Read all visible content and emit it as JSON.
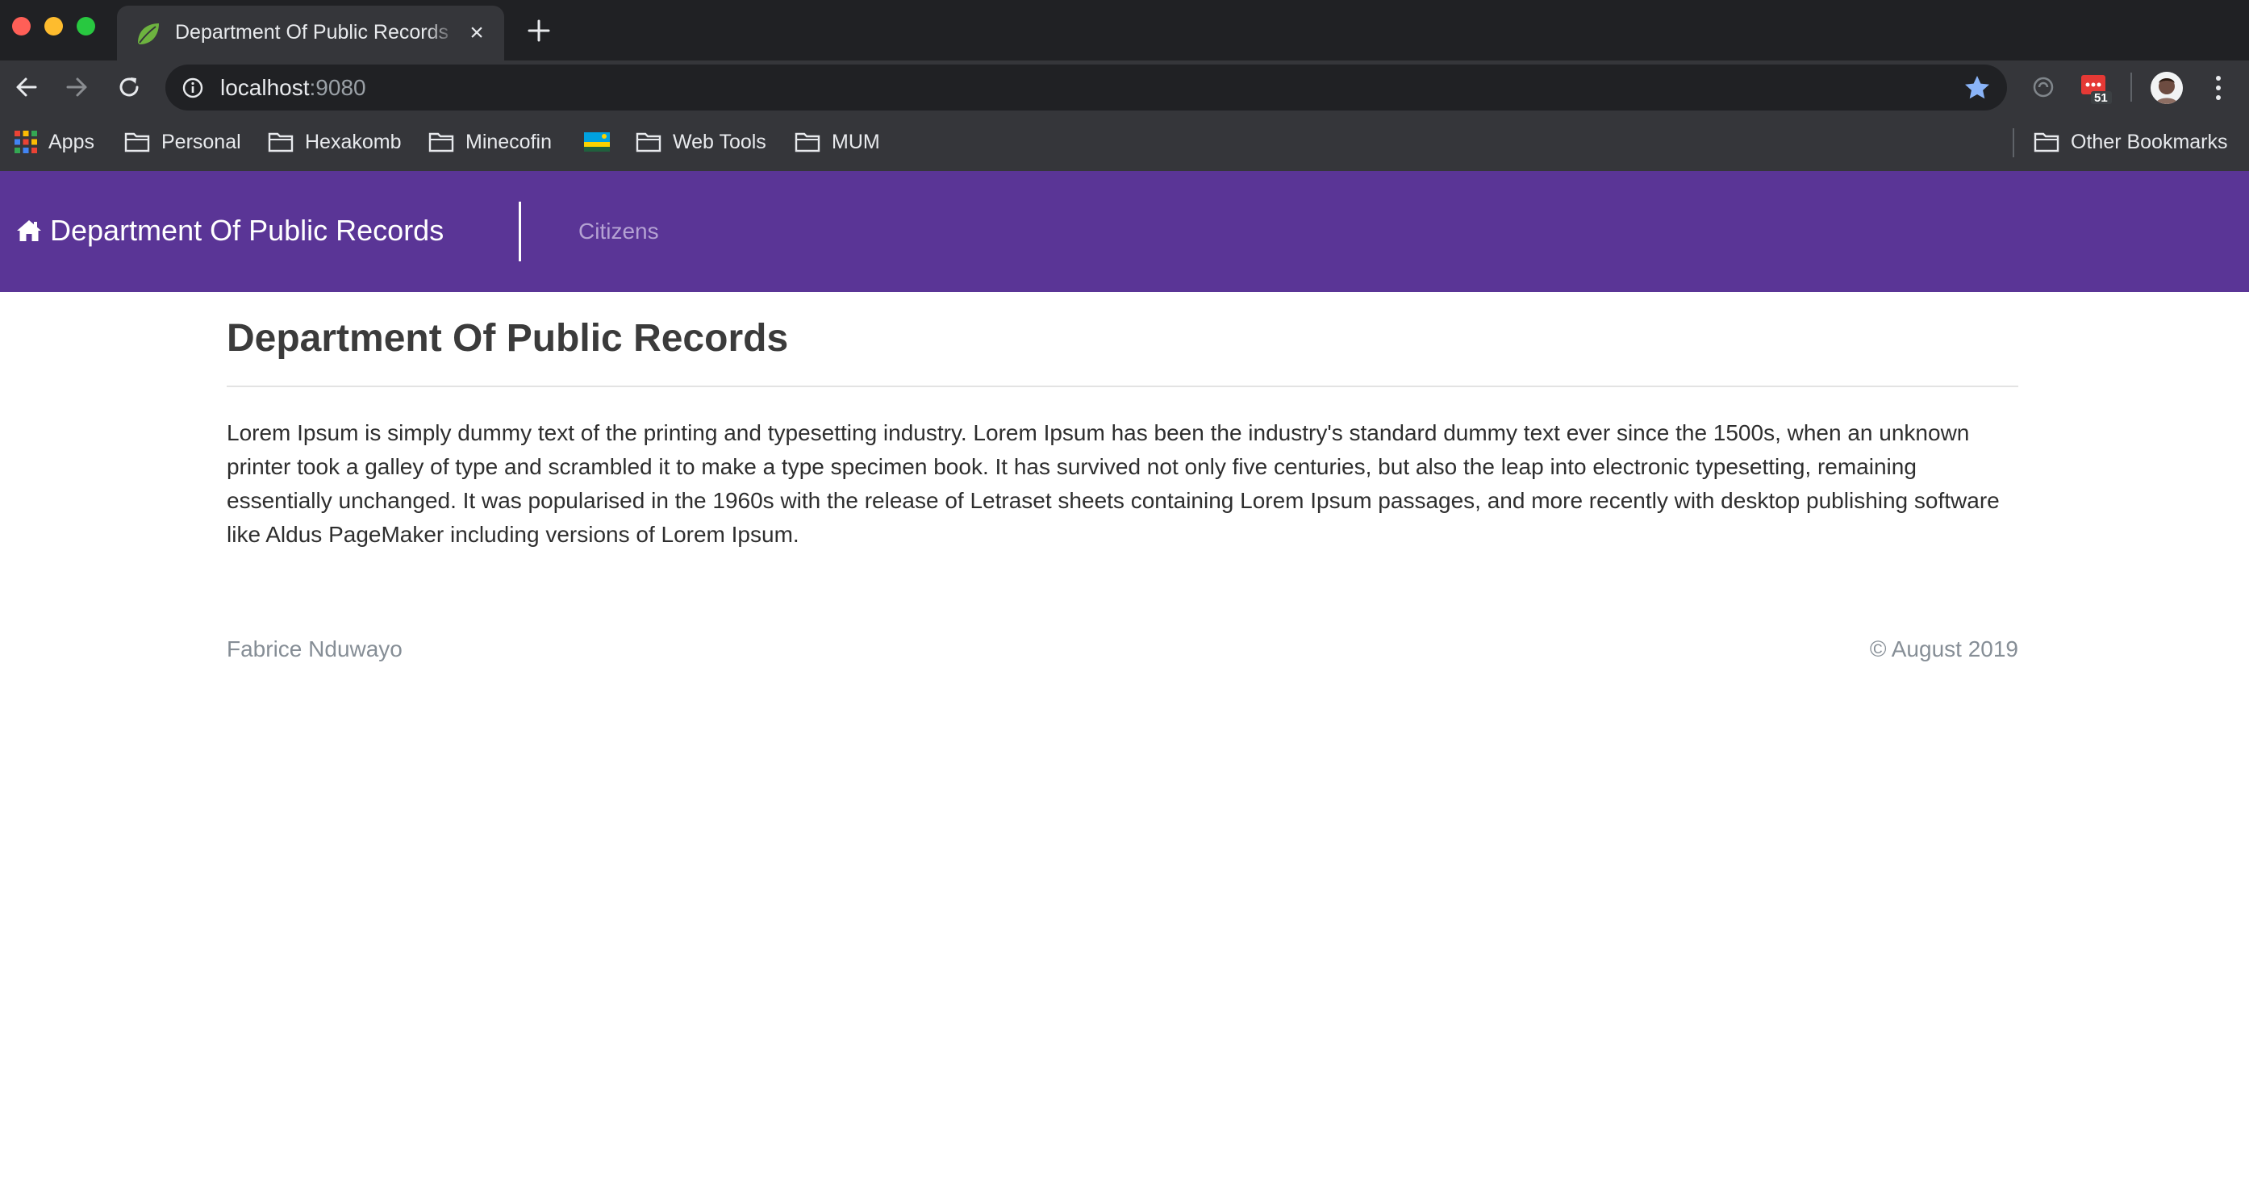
{
  "browser": {
    "tab_title": "Department Of Public Records",
    "tab_close": "×",
    "url_host": "localhost",
    "url_port": ":9080",
    "extension_badge": "51",
    "bookmarks": {
      "apps": "Apps",
      "personal": "Personal",
      "hexakomb": "Hexakomb",
      "minecofin": "Minecofin",
      "web_tools": "Web Tools",
      "mum": "MUM",
      "other": "Other Bookmarks"
    },
    "colors": {
      "tabstrip": "#202124",
      "toolbar": "#35363a",
      "bookmark_star": "#8ab4f8"
    }
  },
  "navbar": {
    "brand": "Department Of Public Records",
    "brand_icon": "home-icon",
    "links": [
      {
        "label": "Citizens"
      }
    ],
    "color": "#5a3596"
  },
  "main": {
    "title": "Department Of Public Records",
    "body": "Lorem Ipsum is simply dummy text of the printing and typesetting industry. Lorem Ipsum has been the industry's standard dummy text ever since the 1500s, when an unknown printer took a galley of type and scrambled it to make a type specimen book. It has survived not only five centuries, but also the leap into electronic typesetting, remaining essentially unchanged. It was popularised in the 1960s with the release of Letraset sheets containing Lorem Ipsum passages, and more recently with desktop publishing software like Aldus PageMaker including versions of Lorem Ipsum."
  },
  "footer": {
    "author": "Fabrice Nduwayo",
    "copyright": "© August 2019"
  }
}
